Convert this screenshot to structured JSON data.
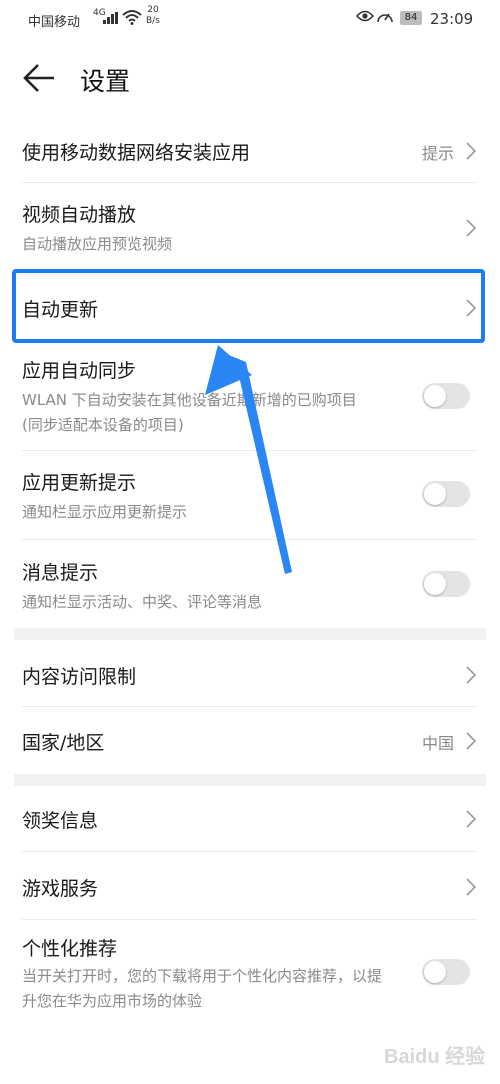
{
  "status_bar": {
    "carrier": "中国移动",
    "network": "4G",
    "speed_value": "20",
    "speed_unit": "B/s",
    "battery": "84",
    "time": "23:09"
  },
  "header": {
    "title": "设置"
  },
  "settings": {
    "mobile_data_install": {
      "label": "使用移动数据网络安装应用",
      "value": "提示"
    },
    "video_autoplay": {
      "label": "视频自动播放",
      "sub": "自动播放应用预览视频"
    },
    "auto_update": {
      "label": "自动更新"
    },
    "auto_sync": {
      "label": "应用自动同步",
      "sub": "WLAN 下自动安装在其他设备近期新增的已购项目 (同步适配本设备的项目)",
      "enabled": false
    },
    "update_notice": {
      "label": "应用更新提示",
      "sub": "通知栏显示应用更新提示",
      "enabled": false
    },
    "message_notice": {
      "label": "消息提示",
      "sub": "通知栏显示活动、中奖、评论等消息",
      "enabled": false
    },
    "content_restriction": {
      "label": "内容访问限制"
    },
    "region": {
      "label": "国家/地区",
      "value": "中国"
    },
    "prize_info": {
      "label": "领奖信息"
    },
    "game_service": {
      "label": "游戏服务"
    },
    "personalized": {
      "label": "个性化推荐",
      "sub": "当开关打开时，您的下载将用于个性化内容推荐，以提升您在华为应用市场的体验",
      "enabled": false
    }
  },
  "annotation": {
    "highlight_color": "#1a7ef0",
    "arrow_color": "#2a86f5"
  },
  "watermark": "Baidu 经验"
}
